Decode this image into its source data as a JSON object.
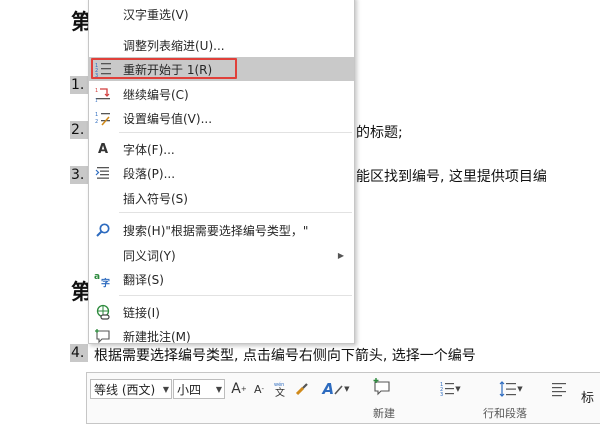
{
  "document": {
    "heading1": "第",
    "heading2": "第",
    "list_numbers": [
      "1.",
      "2.",
      "3.",
      "4."
    ],
    "line2_tail": "的标题;",
    "line3_tail": "能区找到编号, 这里提供项目编",
    "line4_text": "根据需要选择编号类型, 点击编号右侧向下箭头, 选择一个编号",
    "toolbar_tail": "标"
  },
  "context_menu": {
    "items": [
      {
        "label": "汉字重选(V)",
        "icon": ""
      },
      {
        "label": "调整列表缩进(U)...",
        "icon": ""
      },
      {
        "label": "重新开始于 1(R)",
        "icon": "restart-numbering-icon"
      },
      {
        "label": "继续编号(C)",
        "icon": "continue-numbering-icon"
      },
      {
        "label": "设置编号值(V)...",
        "icon": "set-numbering-value-icon"
      },
      {
        "label": "字体(F)...",
        "icon": "font-icon"
      },
      {
        "label": "段落(P)...",
        "icon": "paragraph-icon"
      },
      {
        "label": "插入符号(S)",
        "icon": ""
      },
      {
        "label": "搜索(H)\"根据需要选择编号类型，\"",
        "icon": "search-icon"
      },
      {
        "label": "同义词(Y)",
        "icon": "",
        "submenu": true
      },
      {
        "label": "翻译(S)",
        "icon": "translate-icon"
      },
      {
        "label": "链接(I)",
        "icon": "link-icon"
      },
      {
        "label": "新建批注(M)",
        "icon": "new-comment-icon"
      }
    ]
  },
  "mini_toolbar": {
    "font_name": "等线 (西文)",
    "font_size": "小四",
    "grow_font": "A",
    "shrink_font": "A",
    "new_comment_label": "新建",
    "line_spacing_label": "行和段落",
    "accent_color": "#e0403a"
  }
}
